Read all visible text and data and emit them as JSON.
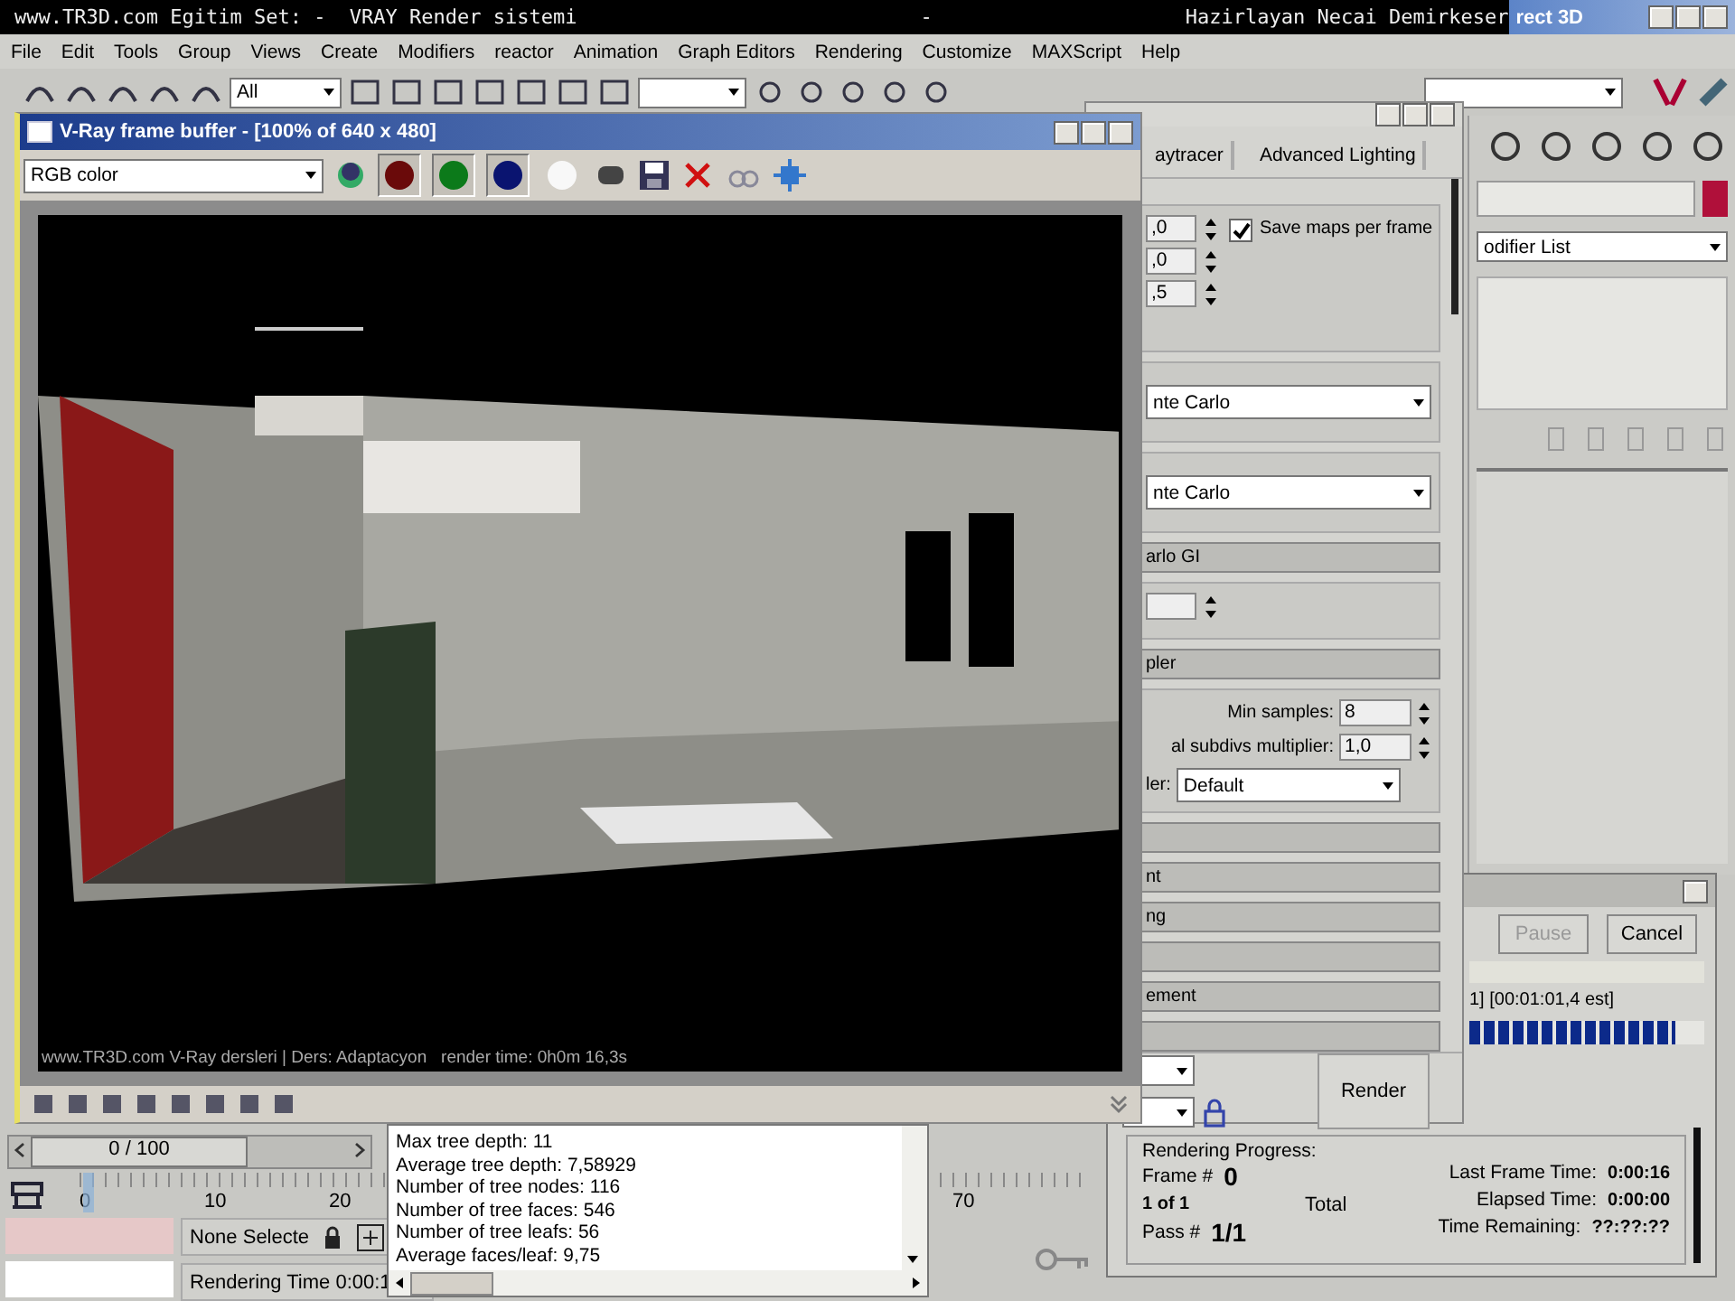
{
  "title_bar": {
    "left": "www.TR3D.com Egitim Set: -  VRAY Render sistemi",
    "middle": "-",
    "right": "Hazirlayan Necai Demirkeser",
    "app_title": "rect 3D"
  },
  "menu": [
    "File",
    "Edit",
    "Tools",
    "Group",
    "Views",
    "Create",
    "Modifiers",
    "reactor",
    "Animation",
    "Graph Editors",
    "Rendering",
    "Customize",
    "MAXScript",
    "Help"
  ],
  "toolbar": {
    "selection_filter": "All"
  },
  "command_panel": {
    "modifier_list": "odifier List"
  },
  "frame_buffer": {
    "title": "V-Ray frame buffer - [100% of 640 x 480]",
    "channel": "RGB color",
    "channel_buttons": [
      {
        "kind": "red",
        "selected": true
      },
      {
        "kind": "green",
        "selected": true
      },
      {
        "kind": "blue",
        "selected": true
      },
      {
        "kind": "alpha",
        "selected": false
      }
    ],
    "caption": "www.TR3D.com V-Ray dersleri | Ders: Adaptacyon   render time: 0h0m 16,3s"
  },
  "render_setup": {
    "tabs": [
      {
        "label": "aytracer",
        "selected": false
      },
      {
        "label": "Advanced Lighting",
        "selected": false
      }
    ],
    "spinners": [
      ",0",
      ",0",
      ",5"
    ],
    "save_maps": {
      "label": "Save maps per frame",
      "checked": true
    },
    "dropdowns": [
      "nte Carlo",
      "nte Carlo"
    ],
    "gi_rollout": "arlo GI",
    "sampler_rollout": "pler",
    "fields": [
      {
        "label": "Min samples:",
        "value": "8"
      },
      {
        "label": "al subdivs multiplier:",
        "value": "1,0"
      }
    ],
    "filter": {
      "label": "ler:",
      "value": "Default"
    },
    "rollouts": [
      {
        "kind": "rollout"
      },
      {
        "kind": "rollout",
        "label": "nt"
      },
      {
        "kind": "rollout",
        "label": "ng"
      },
      {
        "kind": "rollout"
      },
      {
        "kind": "rollout",
        "label": "ement"
      },
      {
        "kind": "rollout"
      }
    ],
    "render_button": "Render"
  },
  "progress": {
    "pause": "Pause",
    "pause_disabled": true,
    "cancel": "Cancel",
    "status": "1] [00:01:01,4 est]",
    "level": 0.88,
    "group_title": "Rendering Progress:",
    "left_rows": [
      {
        "label": "Frame #",
        "value": "0"
      },
      {
        "label": "",
        "value": "1 of 1"
      },
      {
        "label": "Pass #",
        "value": "1/1"
      }
    ],
    "total": "Total",
    "right_rows": [
      {
        "label": "Last Frame Time:",
        "value": "0:00:16"
      },
      {
        "label": "Elapsed Time:",
        "value": "0:00:00"
      },
      {
        "label": "Time Remaining:",
        "value": "??:??:??"
      }
    ]
  },
  "log": [
    "Max tree depth: 11",
    "Average tree depth: 7,58929",
    "Number of tree nodes: 116",
    "Number of tree faces: 546",
    "Number of tree leafs: 56",
    "Average faces/leaf: 9,75"
  ],
  "timeline": {
    "slider": "0 / 100",
    "ticks": [
      "0",
      "10",
      "20",
      "70"
    ]
  },
  "status": {
    "selection": "None Selecte",
    "render_time": "Rendering Time  0:00:1"
  }
}
